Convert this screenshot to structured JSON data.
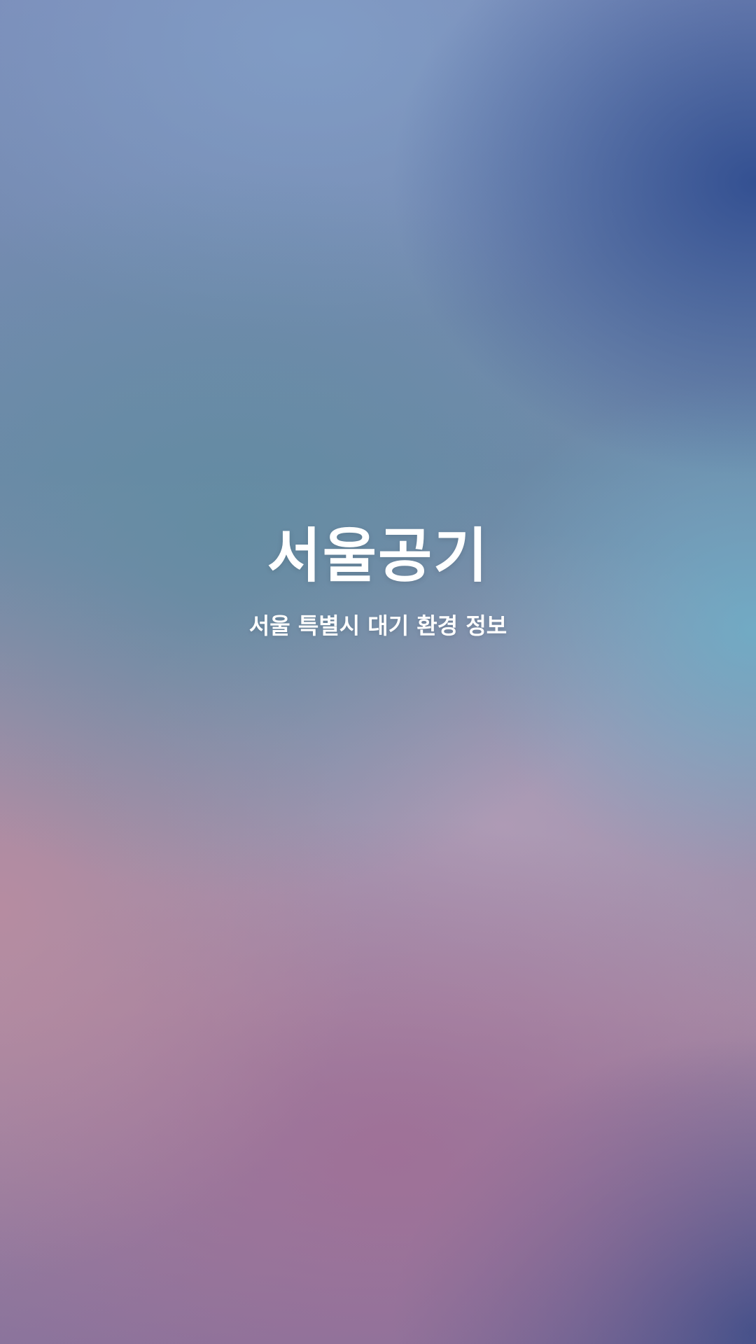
{
  "splash": {
    "app_title": "서울공기",
    "subtitle": "서울 특별시 대기 환경 정보"
  },
  "colors": {
    "text": "#ffffff",
    "background_top": "#7b8cb9",
    "background_bottom": "#8a749c"
  }
}
